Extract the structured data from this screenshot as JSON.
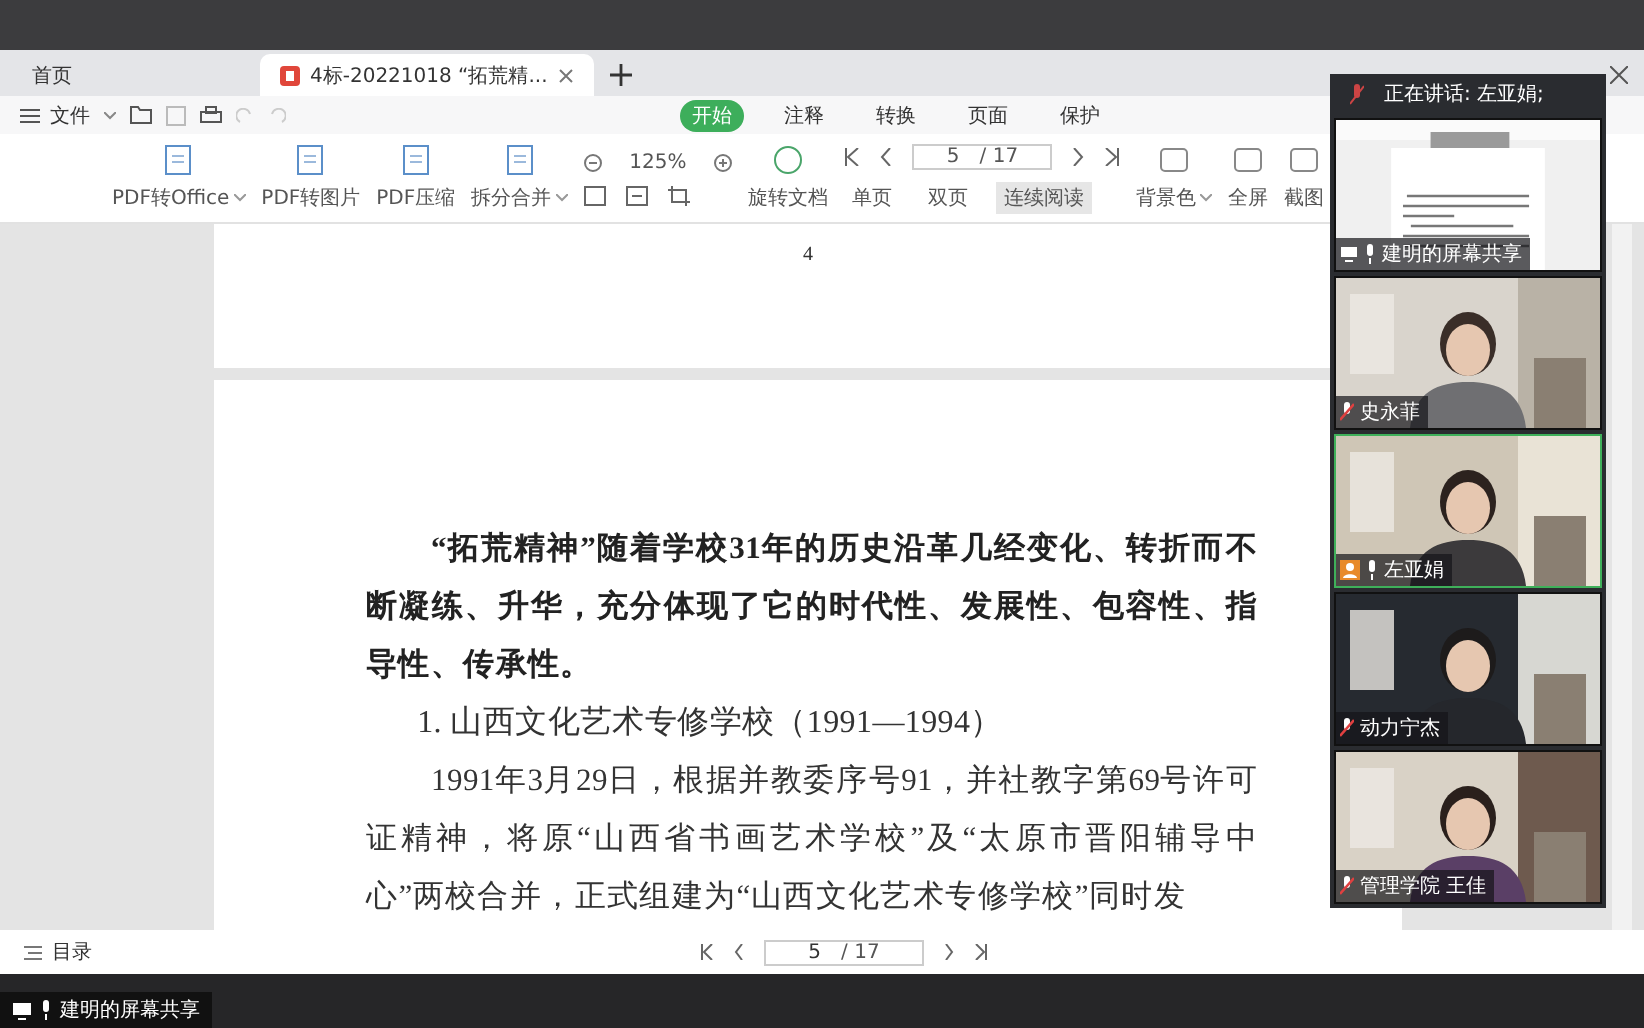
{
  "tabs": [
    {
      "label": "首页",
      "selected": false
    },
    {
      "label": "4标-20221018 “拓荒精...",
      "selected": true
    }
  ],
  "menu": {
    "file_label": "文件",
    "tabs": [
      {
        "label": "开始",
        "selected": true
      },
      {
        "label": "注释",
        "selected": false
      },
      {
        "label": "转换",
        "selected": false
      },
      {
        "label": "页面",
        "selected": false
      },
      {
        "label": "保护",
        "selected": false
      }
    ]
  },
  "toolbar": {
    "tools": [
      {
        "label": "PDF转Office",
        "dropdown": true
      },
      {
        "label": "PDF转图片",
        "dropdown": false
      },
      {
        "label": "PDF压缩",
        "dropdown": false
      },
      {
        "label": "拆分合并",
        "dropdown": true
      }
    ],
    "zoom": "125%",
    "rotate_label": "旋转文档",
    "page": "5",
    "total": "/ 17",
    "view_modes": [
      {
        "label": "单页",
        "selected": false
      },
      {
        "label": "双页",
        "selected": false
      },
      {
        "label": "连续阅读",
        "selected": true
      }
    ],
    "tools_right": [
      {
        "label": "背景色",
        "dropdown": true
      },
      {
        "label": "全屏",
        "dropdown": false
      },
      {
        "label": "截图",
        "dropdown": false
      }
    ]
  },
  "document": {
    "page_number": "4",
    "paragraphs": [
      {
        "kind": "body",
        "bold": true,
        "text": "“拓荒精神”随着学校31年的历史沿革几经变化、转折而不断凝练、升华，充分体现了它的时代性、发展性、包容性、指导性、传承性。"
      },
      {
        "kind": "heading",
        "bold": false,
        "text": "1. 山西文化艺术专修学校（1991—1994）"
      },
      {
        "kind": "body",
        "bold": false,
        "text": "1991年3月29日，根据并教委序号91，并社教字第69号许可证精神，将原“山西省书画艺术学校”及“太原市晋阳辅导中心”两校合并，正式组建为“山西文化艺术专修学校”同时发"
      }
    ]
  },
  "status_bar": {
    "toc_label": "目录",
    "page": "5",
    "total": "/ 17"
  },
  "meeting": {
    "speaking_label": "正在讲话: 左亚娟;",
    "tiles": [
      {
        "kind": "screen",
        "name": "建明的屏幕共享",
        "muted": false,
        "host": false,
        "selected": false
      },
      {
        "kind": "camera",
        "name": "史永菲",
        "muted": true,
        "host": false,
        "selected": false
      },
      {
        "kind": "camera",
        "name": "左亚娟",
        "muted": false,
        "host": true,
        "selected": true
      },
      {
        "kind": "camera",
        "name": "动力宁杰",
        "muted": true,
        "host": false,
        "selected": false
      },
      {
        "kind": "camera",
        "name": "管理学院 王佳",
        "muted": true,
        "host": false,
        "selected": false
      }
    ]
  },
  "share_label": "建明的屏幕共享"
}
